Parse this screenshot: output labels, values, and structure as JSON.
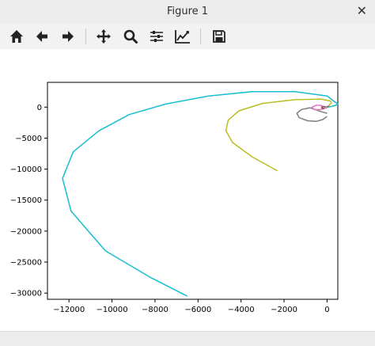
{
  "window": {
    "title": "Figure 1"
  },
  "toolbar": {
    "buttons": [
      {
        "name": "home-button",
        "icon": "home-icon"
      },
      {
        "name": "back-button",
        "icon": "arrow-left-icon"
      },
      {
        "name": "forward-button",
        "icon": "arrow-right-icon"
      },
      {
        "name": "pan-button",
        "icon": "move-icon"
      },
      {
        "name": "zoom-button",
        "icon": "magnifier-icon"
      },
      {
        "name": "subplots-button",
        "icon": "sliders-icon"
      },
      {
        "name": "edit-axis-button",
        "icon": "chart-line-icon"
      },
      {
        "name": "save-button",
        "icon": "floppy-disk-icon"
      }
    ]
  },
  "chart_data": {
    "type": "line",
    "title": "",
    "xlabel": "",
    "ylabel": "",
    "xlim": [
      -13000,
      500
    ],
    "ylim": [
      -31000,
      4000
    ],
    "xticks": [
      -12000,
      -10000,
      -8000,
      -6000,
      -4000,
      -2000,
      0
    ],
    "xtick_labels": [
      "−12000",
      "−10000",
      "−8000",
      "−6000",
      "−4000",
      "−2000",
      "0"
    ],
    "yticks": [
      0,
      -5000,
      -10000,
      -15000,
      -20000,
      -25000,
      -30000
    ],
    "ytick_labels": [
      "0",
      "−5000",
      "−10000",
      "−15000",
      "−20000",
      "−25000",
      "−30000"
    ],
    "grid": false,
    "series": [
      {
        "color": "#17becf",
        "x": [
          0,
          200,
          400,
          500,
          300,
          0,
          -1500,
          -3500,
          -5500,
          -7500,
          -9200,
          -10600,
          -11800,
          -12300,
          -11900,
          -10300,
          -8200,
          -6500
        ],
        "y": [
          0,
          100,
          300,
          500,
          1000,
          1800,
          2500,
          2500,
          1800,
          500,
          -1200,
          -3800,
          -7200,
          -11500,
          -16800,
          -23200,
          -27500,
          -30500
        ]
      },
      {
        "color": "#bcbd22",
        "x": [
          0,
          100,
          200,
          150,
          -300,
          -1500,
          -3000,
          -4100,
          -4600,
          -4700,
          -4400,
          -3500,
          -2300
        ],
        "y": [
          0,
          300,
          700,
          1000,
          1300,
          1200,
          600,
          -600,
          -2100,
          -3800,
          -5700,
          -8000,
          -10300
        ]
      },
      {
        "color": "#7f7f7f",
        "x": [
          0,
          -300,
          -800,
          -1200,
          -1400,
          -1300,
          -900,
          -500,
          -200,
          0
        ],
        "y": [
          -1000,
          -700,
          -100,
          -400,
          -1000,
          -1700,
          -2200,
          -2300,
          -2000,
          -1500
        ]
      },
      {
        "color": "#e377c2",
        "x": [
          -100,
          -300,
          -500,
          -700,
          -600,
          -300,
          0
        ],
        "y": [
          0,
          300,
          300,
          0,
          -400,
          -400,
          -100
        ]
      },
      {
        "color": "#8c564b",
        "x": [
          -50,
          -150,
          -250,
          -250,
          -120
        ],
        "y": [
          0,
          100,
          20,
          -150,
          -200
        ]
      },
      {
        "color": "#9467bd",
        "x": [
          0,
          80,
          40,
          -40
        ],
        "y": [
          0,
          60,
          140,
          80
        ]
      },
      {
        "color": "#2ca02c",
        "x": [
          0,
          30,
          40
        ],
        "y": [
          0,
          30,
          80
        ]
      }
    ]
  }
}
